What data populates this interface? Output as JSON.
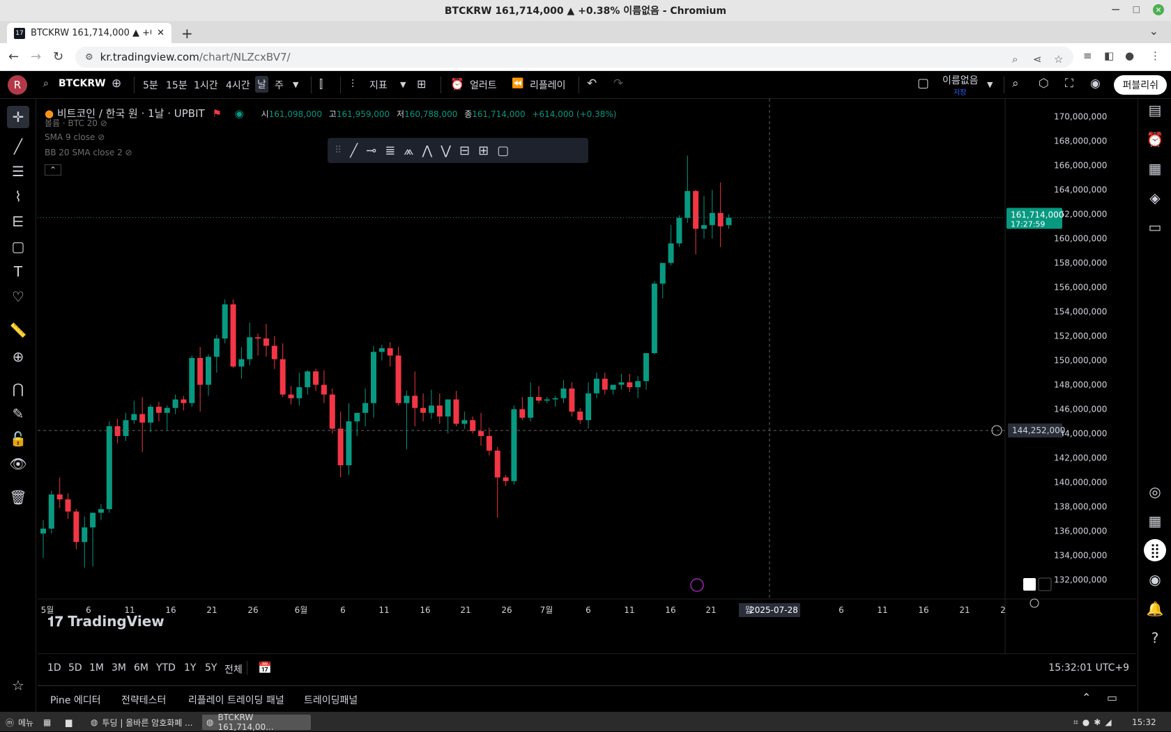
{
  "window": {
    "title": "BTCKRW 161,714,000 ▲ +0.38% 이름없음 - Chromium"
  },
  "browser": {
    "tab_title": "BTCKRW 161,714,000 ▲ +0.38%",
    "url_host": "kr.tradingview.com",
    "url_path": "/chart/NLZcxBV7/"
  },
  "toolbar": {
    "avatar": "R",
    "symbol": "BTCKRW",
    "intervals": [
      "5분",
      "15분",
      "1시간",
      "4시간",
      "날",
      "주"
    ],
    "selected_interval": "날",
    "indicators_label": "지표",
    "alerts_label": "얼러트",
    "replay_label": "리플레이",
    "layout_name": "이름없음",
    "layout_status": "저장",
    "publish_label": "퍼블리쉬"
  },
  "legend": {
    "title": "비트코인 / 한국 원 · 1날 · UPBIT",
    "open_label": "시",
    "open": "161,098,000",
    "high_label": "고",
    "high": "161,959,000",
    "low_label": "저",
    "low": "160,788,000",
    "close_label": "종",
    "close": "161,714,000",
    "change": "+614,000 (+0.38%)",
    "volume": "볼륨 · BTC 20",
    "sma": "SMA 9 close",
    "bb": "BB 20 SMA close 2"
  },
  "logo_text": "TradingView",
  "range_buttons": [
    "1D",
    "5D",
    "1M",
    "3M",
    "6M",
    "YTD",
    "1Y",
    "5Y",
    "전체"
  ],
  "clock": "15:32:01 UTC+9",
  "panels": [
    "Pine 에디터",
    "전략테스터",
    "리플레이 트레이딩 패널",
    "트레이딩패널"
  ],
  "taskbar": {
    "menu": "메뉴",
    "app1": "투딩 | 올바른 암호화폐 ...",
    "app2": "BTCKRW 161,714,00...",
    "time": "15:32"
  },
  "colors": {
    "up": "#089981",
    "down": "#f23645",
    "bg": "#000000",
    "text": "#d1d4dc"
  },
  "chart_data": {
    "type": "candlestick",
    "symbol": "BTCKRW",
    "exchange": "UPBIT",
    "interval": "1날",
    "y_range": [
      131000000,
      171000000
    ],
    "y_ticks": [
      132000000,
      134000000,
      136000000,
      138000000,
      140000000,
      142000000,
      144000000,
      146000000,
      148000000,
      150000000,
      152000000,
      154000000,
      156000000,
      158000000,
      160000000,
      162000000,
      164000000,
      166000000,
      168000000,
      170000000
    ],
    "y_tick_labels": [
      "132,000,000",
      "134,000,000",
      "136,000,000",
      "138,000,000",
      "140,000,000",
      "142,000,000",
      "144,000,000",
      "146,000,000",
      "148,000,000",
      "150,000,000",
      "152,000,000",
      "154,000,000",
      "156,000,000",
      "158,000,000",
      "160,000,000",
      "162,000,000",
      "164,000,000",
      "166,000,000",
      "168,000,000",
      "170,000,000"
    ],
    "x_tick_labels": [
      "5월",
      "6",
      "11",
      "16",
      "21",
      "26",
      "6월",
      "6",
      "11",
      "16",
      "21",
      "26",
      "7월",
      "6",
      "11",
      "16",
      "21",
      "월",
      "6",
      "11",
      "16",
      "21",
      "2"
    ],
    "crosshair_date": "2025-07-28",
    "crosshair_price": "144,252,000",
    "last_price": "161,714,000",
    "countdown": "17:27:59",
    "candles": [
      [
        135.8,
        136.9,
        133.8,
        136.2
      ],
      [
        136.2,
        139.3,
        135.8,
        139.0
      ],
      [
        139.0,
        140.4,
        137.9,
        138.6
      ],
      [
        138.6,
        139.1,
        137.0,
        137.6
      ],
      [
        137.6,
        137.8,
        134.5,
        135.1
      ],
      [
        135.1,
        137.2,
        133.0,
        136.3
      ],
      [
        136.3,
        137.5,
        133.1,
        137.5
      ],
      [
        137.5,
        138.2,
        136.9,
        137.8
      ],
      [
        137.8,
        145.0,
        137.5,
        144.6
      ],
      [
        144.6,
        145.2,
        143.2,
        143.8
      ],
      [
        143.8,
        145.7,
        143.4,
        145.1
      ],
      [
        145.1,
        146.7,
        144.8,
        145.6
      ],
      [
        145.6,
        147.0,
        142.5,
        144.9
      ],
      [
        144.9,
        146.4,
        144.1,
        146.2
      ],
      [
        146.2,
        146.6,
        145.0,
        145.7
      ],
      [
        145.7,
        146.3,
        144.3,
        146.1
      ],
      [
        146.1,
        147.2,
        145.6,
        146.8
      ],
      [
        146.8,
        147.1,
        145.9,
        146.5
      ],
      [
        146.5,
        150.4,
        146.2,
        150.2
      ],
      [
        150.2,
        151.1,
        145.8,
        148.0
      ],
      [
        148.0,
        150.5,
        147.1,
        150.3
      ],
      [
        150.3,
        152.1,
        149.0,
        151.8
      ],
      [
        151.8,
        155.0,
        151.4,
        154.6
      ],
      [
        154.6,
        155.0,
        149.4,
        149.5
      ],
      [
        149.5,
        151.1,
        148.5,
        150.1
      ],
      [
        150.1,
        153.1,
        149.6,
        151.9
      ],
      [
        151.9,
        152.2,
        150.4,
        151.8
      ],
      [
        151.8,
        153.0,
        150.3,
        151.2
      ],
      [
        151.2,
        152.0,
        149.3,
        150.1
      ],
      [
        150.1,
        151.4,
        147.0,
        147.2
      ],
      [
        147.2,
        147.9,
        146.4,
        146.9
      ],
      [
        146.9,
        149.0,
        146.3,
        147.8
      ],
      [
        147.8,
        149.2,
        147.2,
        149.1
      ],
      [
        149.1,
        149.3,
        147.5,
        148.0
      ],
      [
        148.0,
        149.2,
        146.5,
        147.2
      ],
      [
        147.2,
        147.7,
        144.0,
        144.4
      ],
      [
        144.4,
        145.8,
        140.4,
        141.4
      ],
      [
        141.4,
        146.5,
        140.6,
        145.0
      ],
      [
        145.0,
        145.6,
        143.8,
        145.7
      ],
      [
        145.7,
        147.7,
        144.6,
        146.5
      ],
      [
        146.5,
        151.2,
        145.3,
        150.7
      ],
      [
        150.7,
        151.3,
        150.0,
        151.0
      ],
      [
        151.0,
        151.5,
        149.5,
        150.4
      ],
      [
        150.4,
        151.1,
        146.3,
        146.5
      ],
      [
        146.5,
        147.5,
        142.7,
        147.1
      ],
      [
        147.1,
        149.1,
        144.6,
        146.1
      ],
      [
        146.1,
        147.3,
        145.0,
        145.7
      ],
      [
        145.7,
        147.6,
        145.2,
        146.3
      ],
      [
        146.3,
        147.3,
        144.8,
        145.4
      ],
      [
        145.4,
        146.7,
        144.0,
        146.8
      ],
      [
        146.8,
        147.5,
        144.6,
        144.8
      ],
      [
        144.8,
        145.8,
        144.4,
        145.1
      ],
      [
        145.1,
        145.4,
        144.0,
        144.2
      ],
      [
        144.2,
        145.7,
        143.0,
        143.8
      ],
      [
        143.8,
        144.5,
        142.2,
        142.6
      ],
      [
        142.6,
        142.9,
        137.1,
        140.4
      ],
      [
        140.4,
        140.6,
        139.7,
        140.1
      ],
      [
        140.1,
        146.3,
        139.8,
        146.0
      ],
      [
        146.0,
        147.0,
        145.1,
        145.3
      ],
      [
        145.3,
        148.2,
        145.0,
        147.0
      ],
      [
        147.0,
        147.9,
        146.5,
        146.7
      ],
      [
        146.7,
        147.0,
        146.5,
        146.8
      ],
      [
        146.8,
        147.1,
        146.2,
        146.9
      ],
      [
        146.9,
        148.4,
        146.5,
        147.7
      ],
      [
        147.7,
        148.2,
        145.4,
        145.8
      ],
      [
        145.8,
        146.1,
        144.8,
        145.1
      ],
      [
        145.1,
        148.2,
        144.4,
        147.3
      ],
      [
        147.3,
        149.0,
        146.9,
        148.5
      ],
      [
        148.5,
        149.0,
        147.2,
        147.6
      ],
      [
        147.6,
        148.0,
        147.2,
        148.0
      ],
      [
        148.0,
        148.9,
        147.6,
        148.2
      ],
      [
        148.2,
        148.9,
        147.4,
        147.8
      ],
      [
        147.8,
        148.7,
        146.9,
        148.3
      ],
      [
        148.3,
        150.4,
        147.6,
        150.6
      ],
      [
        150.6,
        156.5,
        150.5,
        156.3
      ],
      [
        156.3,
        157.9,
        155.1,
        158.0
      ],
      [
        158.0,
        161.1,
        157.8,
        159.6
      ],
      [
        159.6,
        161.9,
        159.3,
        161.7
      ],
      [
        161.7,
        166.8,
        161.3,
        163.9
      ],
      [
        163.9,
        164.0,
        158.7,
        160.8
      ],
      [
        160.8,
        163.5,
        160.0,
        161.1
      ],
      [
        161.1,
        164.0,
        160.0,
        162.1
      ],
      [
        162.1,
        164.6,
        159.3,
        161.0
      ],
      [
        161.1,
        162.0,
        160.8,
        161.7
      ]
    ]
  }
}
